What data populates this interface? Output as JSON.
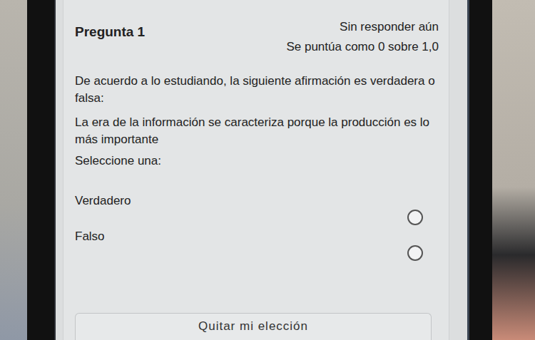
{
  "question": {
    "title": "Pregunta 1",
    "status": "Sin responder aún",
    "grade": "Se puntúa como 0 sobre 1,0",
    "prompt": "De acuerdo a lo estudiando, la siguiente afirmación es verdadera o falsa:",
    "statement": "La era de la información se caracteriza porque la producción es lo más importante",
    "instruction": "Seleccione una:",
    "options": [
      {
        "label": "Verdadero",
        "selected": false
      },
      {
        "label": "Falso",
        "selected": false
      }
    ],
    "clear_button": "Quitar mi elección"
  }
}
